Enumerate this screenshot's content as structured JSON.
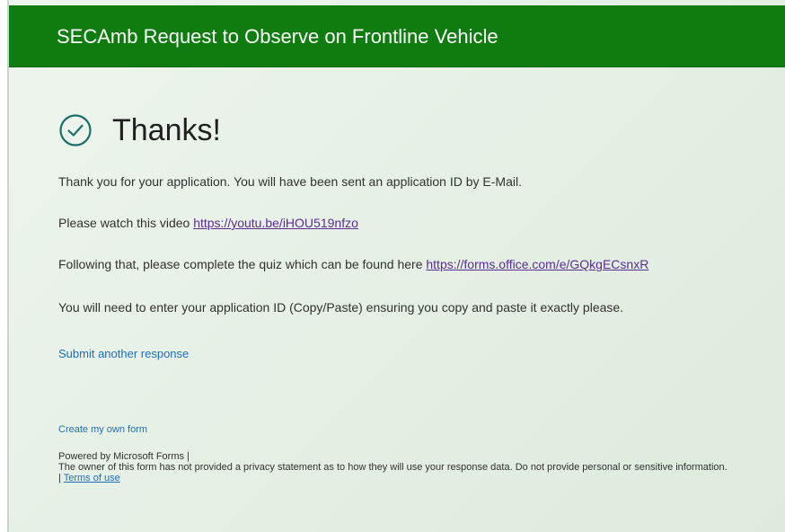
{
  "header": {
    "title": "SECAmb Request to Observe on Frontline Vehicle"
  },
  "confirmation": {
    "icon": "checkmark-circle-icon",
    "title": "Thanks!",
    "message1": "Thank you for your application. You will have been sent an application ID by E-Mail.",
    "message2_prefix": "Please watch this video ",
    "video_link": "https://youtu.be/iHOU519nfzo",
    "message3_prefix": "Following that, please complete the quiz which can be found here ",
    "quiz_link": "https://forms.office.com/e/GQkgECsnxR",
    "message4": "You will need to enter your application ID (Copy/Paste) ensuring you copy and paste it exactly please.",
    "submit_another": "Submit another response"
  },
  "footer": {
    "create_form": "Create my own form",
    "powered_by": "Powered by Microsoft Forms |",
    "privacy_notice": "The owner of this form has not provided a privacy statement as to how they will use your response data. Do not provide personal or sensitive information.",
    "terms_prefix": "| ",
    "terms_link": "Terms of use"
  },
  "colors": {
    "header_bg": "#0f7c10",
    "icon": "#1b6e6e",
    "link": "#1e6fb8",
    "visited_link": "#5b2c91"
  }
}
